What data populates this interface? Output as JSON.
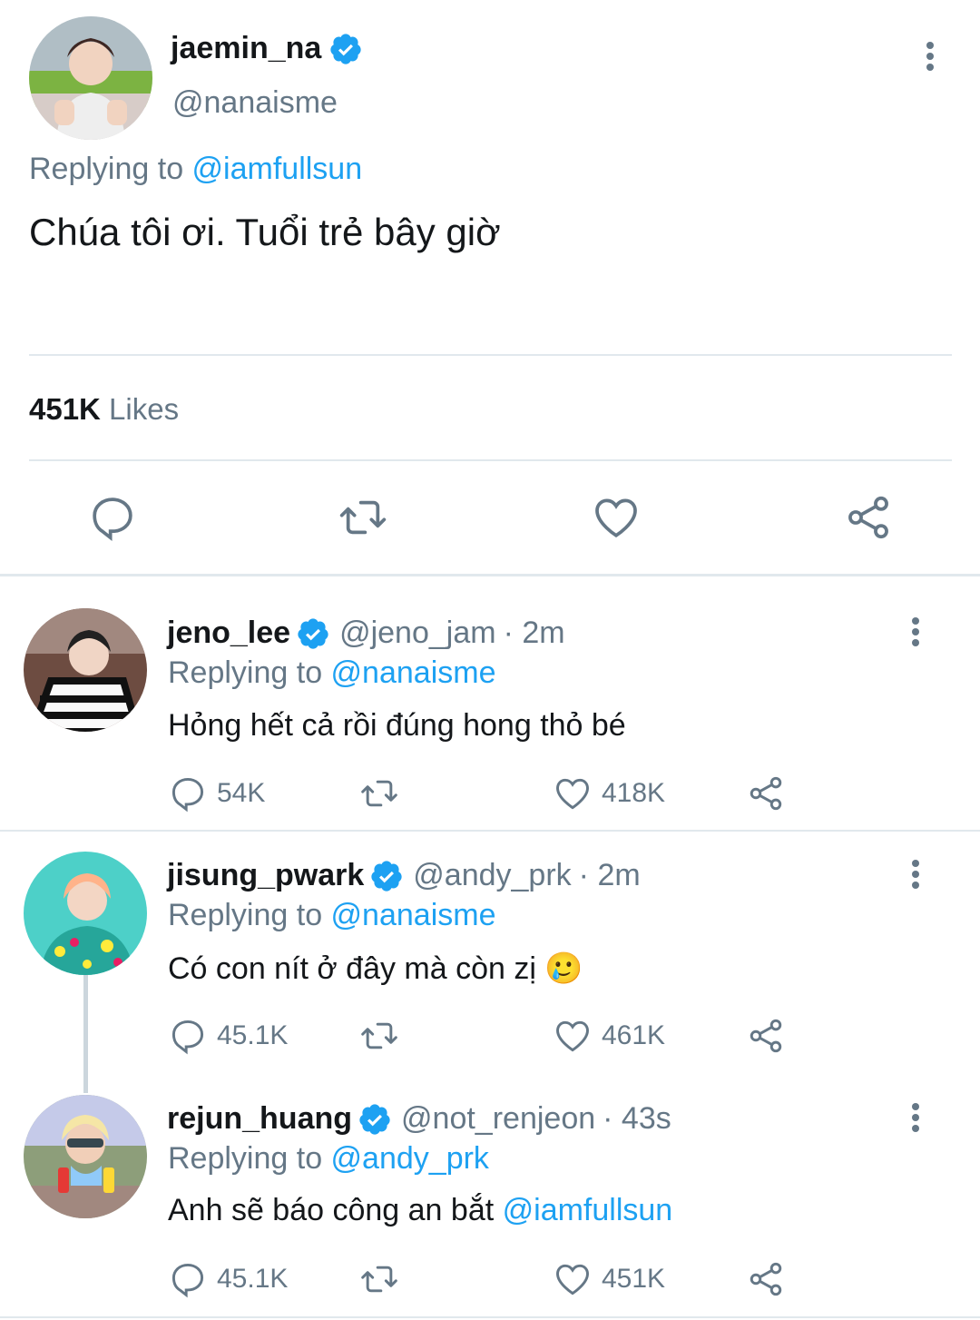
{
  "main_tweet": {
    "name": "jaemin_na",
    "handle": "@nanaisme",
    "replying_label": "Replying to ",
    "replying_to": "@iamfullsun",
    "text": "Chúa tôi ơi. Tuổi trẻ bây giờ",
    "likes_count": "451K",
    "likes_label": " Likes"
  },
  "replies": [
    {
      "name": "jeno_lee",
      "handle": "@jeno_jam",
      "time": "· 2m",
      "replying_label": "Replying to ",
      "replying_to": "@nanaisme",
      "text": "Hỏng hết cả rồi đúng hong thỏ bé",
      "mention": "",
      "replies": "54K",
      "likes": "418K"
    },
    {
      "name": "jisung_pwark",
      "handle": "@andy_prk",
      "time": "· 2m",
      "replying_label": "Replying to ",
      "replying_to": "@nanaisme",
      "text": "Có con nít ở đây mà còn zị 🥲",
      "mention": "",
      "replies": "45.1K",
      "likes": "461K"
    },
    {
      "name": "rejun_huang",
      "handle": "@not_renjeon",
      "time": "· 43s",
      "replying_label": "Replying to ",
      "replying_to": "@andy_prk",
      "text": "Anh sẽ báo công an bắt ",
      "mention": "@iamfullsun",
      "replies": "45.1K",
      "likes": "451K"
    }
  ],
  "colors": {
    "accent": "#1da1f2",
    "muted": "#657786",
    "divider": "#e1e8ed"
  },
  "icons": [
    "verified-badge-icon",
    "more-vertical-icon",
    "reply-icon",
    "retweet-icon",
    "like-icon",
    "share-icon"
  ]
}
